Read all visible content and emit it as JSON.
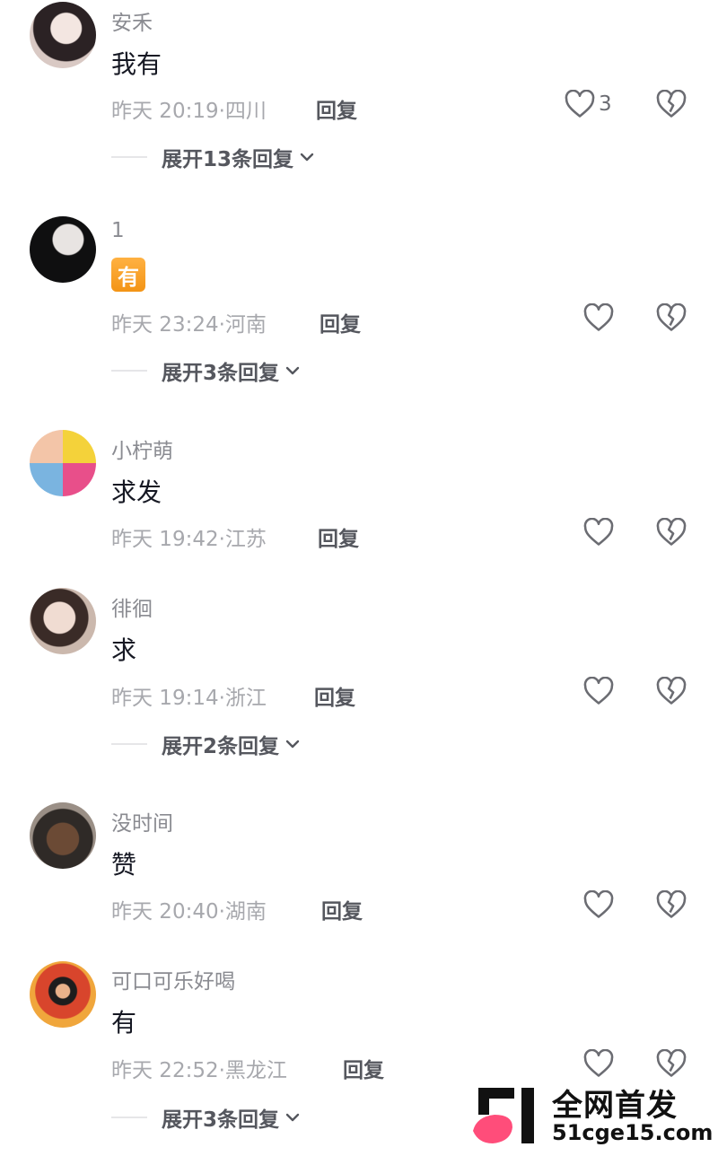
{
  "comments": [
    {
      "username": "安禾",
      "text": "我有",
      "time": "昨天 20:19",
      "location": "四川",
      "reply_label": "回复",
      "like_count": "3",
      "expand_label": "展开13条回复"
    },
    {
      "username": "1",
      "text": "有",
      "time": "昨天 23:24",
      "location": "河南",
      "reply_label": "回复",
      "like_count": "",
      "expand_label": "展开3条回复"
    },
    {
      "username": "小柠萌",
      "text": "求发",
      "time": "昨天 19:42",
      "location": "江苏",
      "reply_label": "回复",
      "like_count": "",
      "expand_label": ""
    },
    {
      "username": "徘徊",
      "text": "求",
      "time": "昨天 19:14",
      "location": "浙江",
      "reply_label": "回复",
      "like_count": "",
      "expand_label": "展开2条回复"
    },
    {
      "username": "没时间",
      "text": "赞",
      "time": "昨天 20:40",
      "location": "湖南",
      "reply_label": "回复",
      "like_count": "",
      "expand_label": ""
    },
    {
      "username": "可口可乐好喝",
      "text": "有",
      "time": "昨天 22:52",
      "location": "黑龙江",
      "reply_label": "回复",
      "like_count": "",
      "expand_label": "展开3条回复"
    }
  ],
  "icons": {
    "like": "heart-outline-icon",
    "dislike": "broken-heart-icon",
    "expand": "chevron-down-icon"
  },
  "watermark": {
    "title": "全网首发",
    "url": "51cge15.com"
  },
  "colors": {
    "meta": "#a7a8ad",
    "username": "#8a8b91",
    "text": "#161823",
    "emoji_badge": "#f7a323",
    "watermark_accent": "#ff4d7a"
  }
}
